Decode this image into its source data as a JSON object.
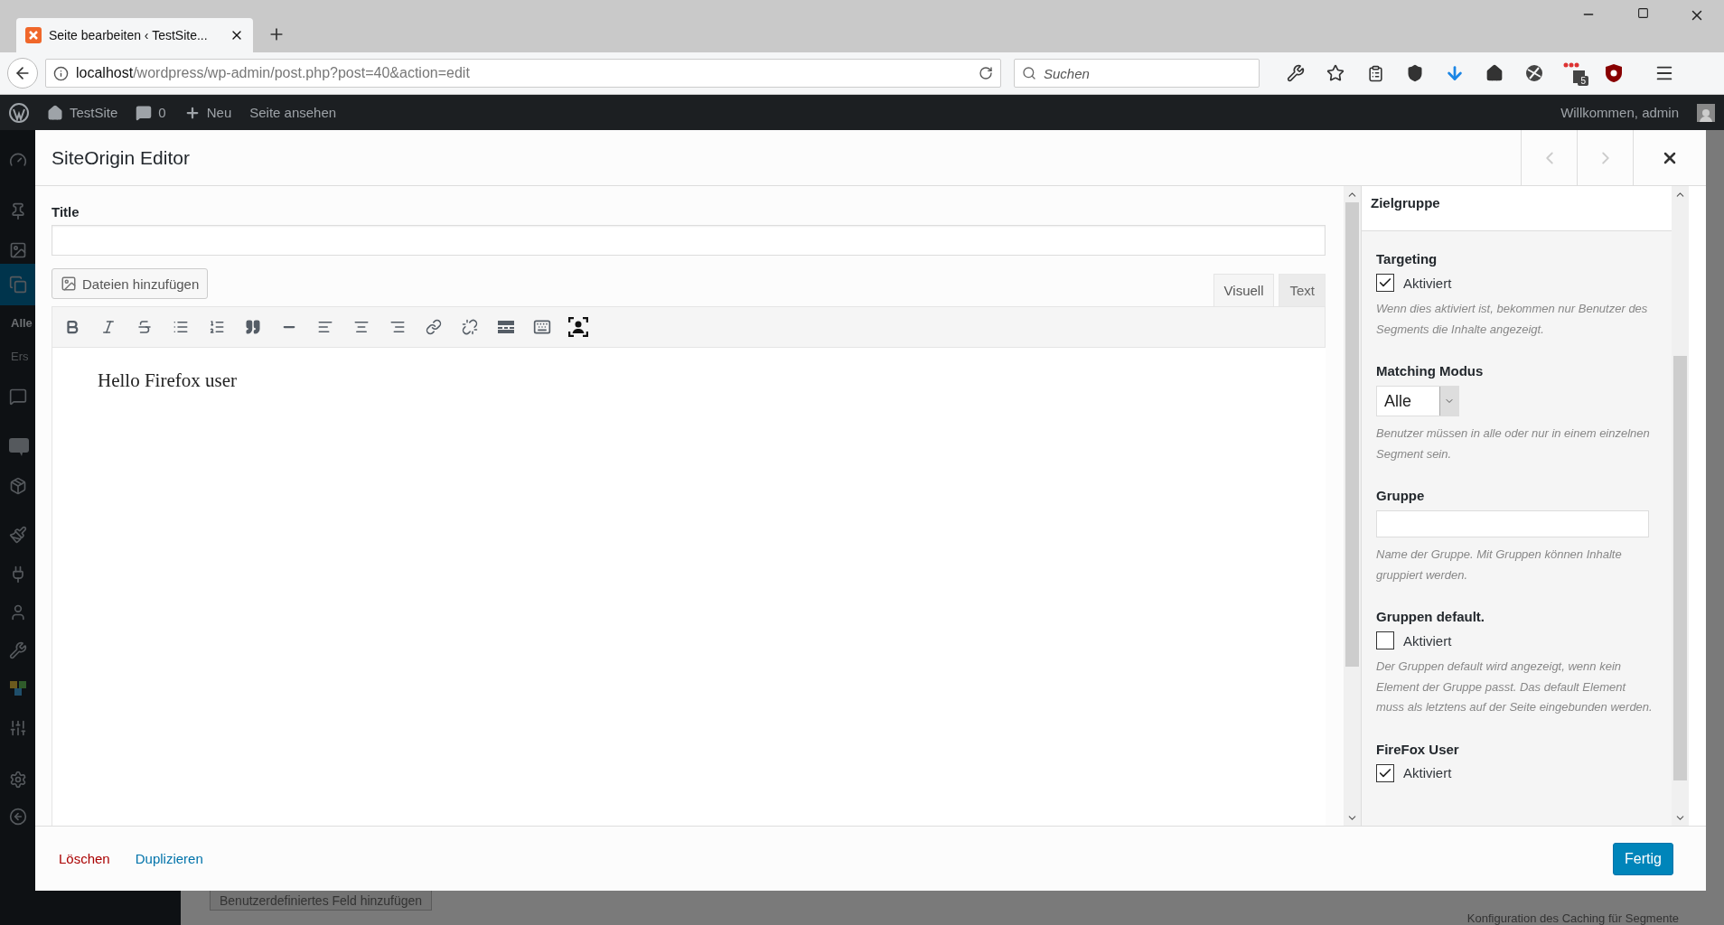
{
  "browser": {
    "tab": {
      "title": "Seite bearbeiten ‹ TestSite...",
      "selected": true
    },
    "url_host": "localhost",
    "url_path": "/wordpress/wp-admin/post.php?post=40&action=edit",
    "search_placeholder": "Suchen",
    "badge": "5"
  },
  "admin_bar": {
    "site": "TestSite",
    "comments": "0",
    "new": "Neu",
    "view": "Seite ansehen",
    "greeting": "Willkommen, admin"
  },
  "sidebar": {
    "labels": [
      "Alle",
      "Ers"
    ]
  },
  "modal": {
    "title": "SiteOrigin Editor",
    "title_label": "Title",
    "add_media": "Dateien hinzufügen",
    "editor_tabs": [
      {
        "label": "Visuell",
        "selected": true
      },
      {
        "label": "Text",
        "selected": false
      }
    ],
    "content": "Hello Firefox user"
  },
  "panel": {
    "title": "Zielgruppe",
    "fields": [
      {
        "kind": "checkbox",
        "label": "Targeting",
        "option": "Aktiviert",
        "checked": true,
        "help": "Wenn dies aktiviert ist, bekommen nur Benutzer des Segments die Inhalte angezeigt."
      },
      {
        "kind": "select",
        "label": "Matching Modus",
        "value": "Alle",
        "help": "Benutzer müssen in alle oder nur in einem einzelnen Segment sein."
      },
      {
        "kind": "text",
        "label": "Gruppe",
        "help": "Name der Gruppe. Mit Gruppen können Inhalte gruppiert werden."
      },
      {
        "kind": "checkbox",
        "label": "Gruppen default.",
        "option": "Aktiviert",
        "checked": false,
        "help": "Der Gruppen default wird angezeigt, wenn kein Element der Gruppe passt. Das default Element muss als letztens auf der Seite eingebunden werden."
      },
      {
        "kind": "checkbox",
        "label": "FireFox User",
        "option": "Aktiviert",
        "checked": true
      }
    ]
  },
  "footer": {
    "delete": "Löschen",
    "duplicate": "Duplizieren",
    "done": "Fertig"
  },
  "background": {
    "button": "Benutzerdefiniertes Feld hinzufügen",
    "heading": "Konfiguration des Caching für Segmente"
  }
}
